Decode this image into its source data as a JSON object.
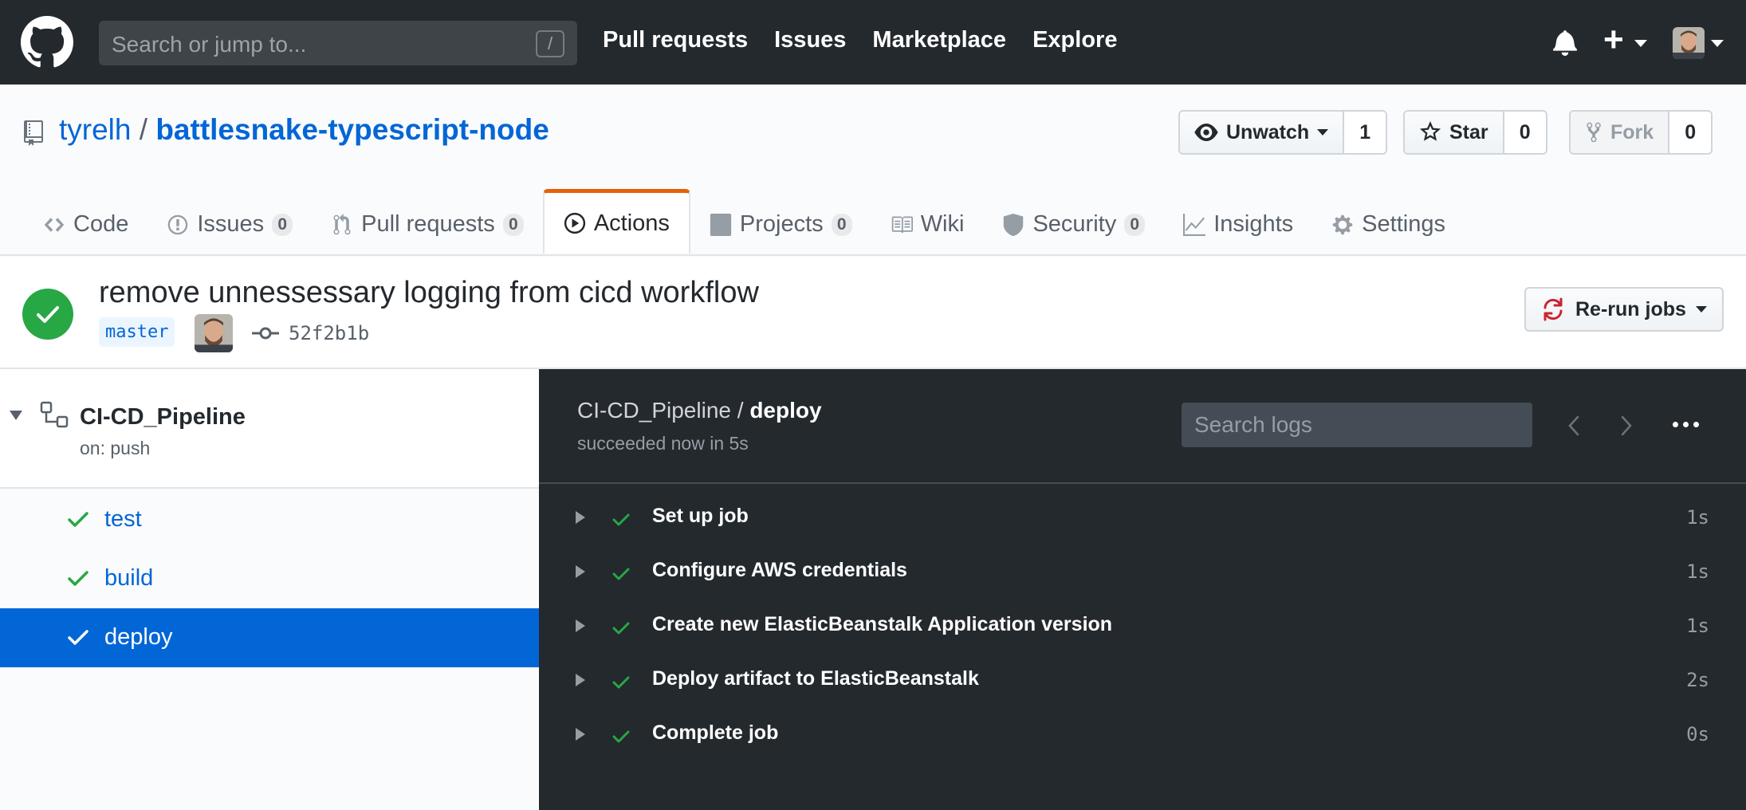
{
  "header": {
    "search_placeholder": "Search or jump to...",
    "search_shortcut": "/",
    "nav": [
      "Pull requests",
      "Issues",
      "Marketplace",
      "Explore"
    ]
  },
  "repo": {
    "owner": "tyrelh",
    "separator": "/",
    "name": "battlesnake-typescript-node",
    "watch": {
      "label": "Unwatch",
      "count": "1"
    },
    "star": {
      "label": "Star",
      "count": "0"
    },
    "fork": {
      "label": "Fork",
      "count": "0"
    }
  },
  "tabs": [
    {
      "label": "Code",
      "count": null,
      "icon": "code-icon"
    },
    {
      "label": "Issues",
      "count": "0",
      "icon": "issue-icon"
    },
    {
      "label": "Pull requests",
      "count": "0",
      "icon": "pull-request-icon"
    },
    {
      "label": "Actions",
      "count": null,
      "icon": "play-icon",
      "active": true
    },
    {
      "label": "Projects",
      "count": "0",
      "icon": "project-icon"
    },
    {
      "label": "Wiki",
      "count": null,
      "icon": "book-icon"
    },
    {
      "label": "Security",
      "count": "0",
      "icon": "shield-icon"
    },
    {
      "label": "Insights",
      "count": null,
      "icon": "graph-icon"
    },
    {
      "label": "Settings",
      "count": null,
      "icon": "gear-icon"
    }
  ],
  "run": {
    "title": "remove unnessessary logging from cicd workflow",
    "branch": "master",
    "commit_sha": "52f2b1b",
    "rerun_label": "Re-run jobs",
    "status": "success"
  },
  "workflow": {
    "name": "CI-CD_Pipeline",
    "trigger": "on: push",
    "jobs": [
      {
        "name": "test",
        "status": "success"
      },
      {
        "name": "build",
        "status": "success"
      },
      {
        "name": "deploy",
        "status": "success",
        "selected": true
      }
    ]
  },
  "log": {
    "path_workflow": "CI-CD_Pipeline",
    "path_sep": " / ",
    "path_job": "deploy",
    "summary": "succeeded now in 5s",
    "search_placeholder": "Search logs",
    "steps": [
      {
        "name": "Set up job",
        "duration": "1s"
      },
      {
        "name": "Configure AWS credentials",
        "duration": "1s"
      },
      {
        "name": "Create new ElasticBeanstalk Application version",
        "duration": "1s"
      },
      {
        "name": "Deploy artifact to ElasticBeanstalk",
        "duration": "2s"
      },
      {
        "name": "Complete job",
        "duration": "0s"
      }
    ]
  },
  "colors": {
    "header_bg": "#24292e",
    "link": "#0366d6",
    "success": "#28a745",
    "active_tab_accent": "#e36209",
    "log_bg": "#24292e",
    "selected_job_bg": "#0366d6"
  }
}
